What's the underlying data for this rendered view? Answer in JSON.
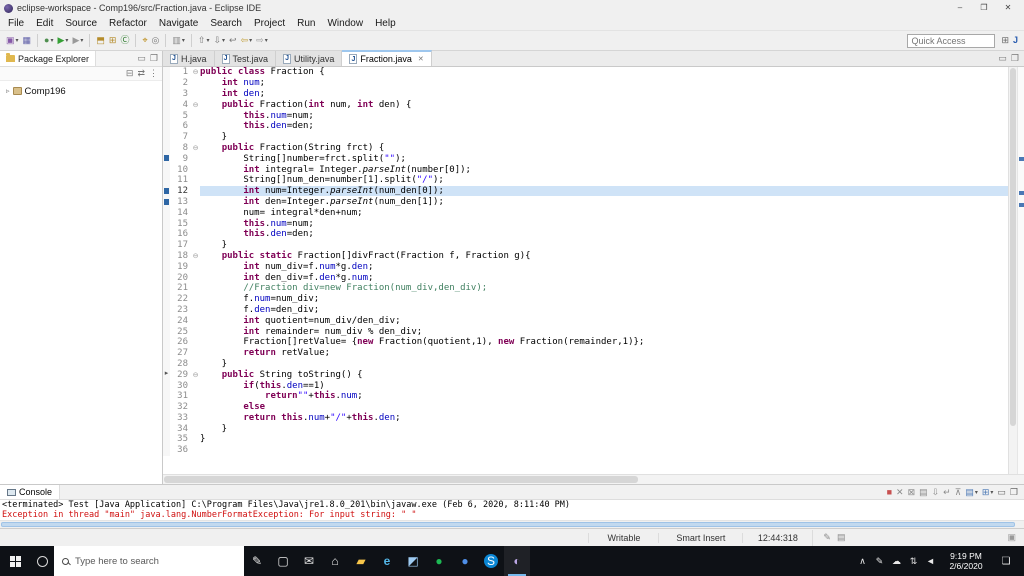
{
  "titlebar": {
    "title": "eclipse-workspace - Comp196/src/Fraction.java - Eclipse IDE",
    "controls": [
      {
        "name": "minimize-button",
        "glyph": "–",
        "color": "#444"
      },
      {
        "name": "restore-button",
        "glyph": "❐",
        "color": "#444"
      },
      {
        "name": "close-button",
        "glyph": "✕",
        "color": "#444"
      }
    ]
  },
  "menubar": [
    "File",
    "Edit",
    "Source",
    "Refactor",
    "Navigate",
    "Search",
    "Project",
    "Run",
    "Window",
    "Help"
  ],
  "toolbar": {
    "quick_access_placeholder": "Quick Access",
    "icons": [
      {
        "name": "new-wizard-button",
        "glyph": "▣",
        "color": "#8659a8",
        "dd": true
      },
      {
        "name": "save-button",
        "glyph": "▦",
        "color": "#5f5fa8"
      },
      {
        "sep": true
      },
      {
        "name": "debug-button",
        "glyph": "●",
        "color": "#4f8f4f",
        "dd": true
      },
      {
        "name": "run-button",
        "glyph": "▶",
        "color": "#35a035",
        "dd": true
      },
      {
        "name": "external-tools-button",
        "glyph": "▶",
        "color": "#9a9a9a",
        "dd": true
      },
      {
        "sep": true
      },
      {
        "name": "new-java-project-button",
        "glyph": "⬒",
        "color": "#b58c2a"
      },
      {
        "name": "new-package-button",
        "glyph": "⊞",
        "color": "#b58c2a"
      },
      {
        "name": "new-class-button",
        "glyph": "Ⓒ",
        "color": "#2a7a2a"
      },
      {
        "sep": true
      },
      {
        "name": "open-type-button",
        "glyph": "⌖",
        "color": "#b8860b"
      },
      {
        "name": "search-button",
        "glyph": "◎",
        "color": "#777777"
      },
      {
        "sep": true
      },
      {
        "name": "coverage-button",
        "glyph": "▥",
        "color": "#888888",
        "dd": true
      },
      {
        "sep": true
      },
      {
        "name": "previous-annotation-button",
        "glyph": "⇧",
        "color": "#777777",
        "dd": true
      },
      {
        "name": "next-annotation-button",
        "glyph": "⇩",
        "color": "#777777",
        "dd": true
      },
      {
        "name": "last-edit-location-button",
        "glyph": "↩",
        "color": "#777777"
      },
      {
        "name": "back-button",
        "glyph": "⇦",
        "color": "#c2a03c",
        "dd": true
      },
      {
        "name": "forward-button",
        "glyph": "⇨",
        "color": "#9a9a9a",
        "dd": true
      }
    ],
    "perspective_icons": [
      {
        "name": "open-perspective-button",
        "glyph": "⊞",
        "color": "#666666"
      },
      {
        "name": "java-perspective-button",
        "glyph": "J",
        "color": "#2a5db0",
        "bold": true
      }
    ]
  },
  "explorer": {
    "title": "Package Explorer",
    "project": "Comp196",
    "header_icons": [
      {
        "name": "minimize-view-button",
        "glyph": "▭",
        "color": "#777777"
      },
      {
        "name": "maximize-view-button",
        "glyph": "❐",
        "color": "#777777"
      }
    ],
    "toolbar_icons": [
      {
        "name": "collapse-all-button",
        "glyph": "⊟",
        "color": "#777777"
      },
      {
        "name": "link-with-editor-button",
        "glyph": "⇄",
        "color": "#777777"
      },
      {
        "name": "view-menu-button",
        "glyph": "⋮",
        "color": "#777777"
      }
    ]
  },
  "editor": {
    "tabs": [
      {
        "label": "H.java",
        "active": false
      },
      {
        "label": "Test.java",
        "active": false
      },
      {
        "label": "Utility.java",
        "active": false
      },
      {
        "label": "Fraction.java",
        "active": true
      }
    ],
    "tabbar_icons": [
      {
        "name": "minimize-view-button",
        "glyph": "▭",
        "color": "#777777"
      },
      {
        "name": "maximize-view-button",
        "glyph": "❐",
        "color": "#777777"
      }
    ],
    "lines": [
      {
        "n": 1,
        "fold": true,
        "seg": [
          [
            "k",
            "public"
          ],
          [
            "p",
            " "
          ],
          [
            "k",
            "class"
          ],
          [
            "p",
            " Fraction {"
          ]
        ]
      },
      {
        "n": 2,
        "seg": [
          [
            "p",
            "    "
          ],
          [
            "k",
            "int"
          ],
          [
            "p",
            " "
          ],
          [
            "f",
            "num"
          ],
          [
            "p",
            ";"
          ]
        ]
      },
      {
        "n": 3,
        "seg": [
          [
            "p",
            "    "
          ],
          [
            "k",
            "int"
          ],
          [
            "p",
            " "
          ],
          [
            "f",
            "den"
          ],
          [
            "p",
            ";"
          ]
        ]
      },
      {
        "n": 4,
        "fold": true,
        "seg": [
          [
            "p",
            "    "
          ],
          [
            "k",
            "public"
          ],
          [
            "p",
            " Fraction("
          ],
          [
            "k",
            "int"
          ],
          [
            "p",
            " num, "
          ],
          [
            "k",
            "int"
          ],
          [
            "p",
            " den) {"
          ]
        ]
      },
      {
        "n": 5,
        "seg": [
          [
            "p",
            "        "
          ],
          [
            "k",
            "this"
          ],
          [
            "p",
            "."
          ],
          [
            "f",
            "num"
          ],
          [
            "p",
            "=num;"
          ]
        ]
      },
      {
        "n": 6,
        "seg": [
          [
            "p",
            "        "
          ],
          [
            "k",
            "this"
          ],
          [
            "p",
            "."
          ],
          [
            "f",
            "den"
          ],
          [
            "p",
            "=den;"
          ]
        ]
      },
      {
        "n": 7,
        "seg": [
          [
            "p",
            "    }"
          ]
        ]
      },
      {
        "n": 8,
        "fold": true,
        "seg": [
          [
            "p",
            "    "
          ],
          [
            "k",
            "public"
          ],
          [
            "p",
            " Fraction(String frct) {"
          ]
        ]
      },
      {
        "n": 9,
        "mark": true,
        "seg": [
          [
            "p",
            "        String[]number=frct.split("
          ],
          [
            "s",
            "\"\""
          ],
          [
            "p",
            ");"
          ]
        ]
      },
      {
        "n": 10,
        "seg": [
          [
            "p",
            "        "
          ],
          [
            "k",
            "int"
          ],
          [
            "p",
            " integral= Integer."
          ],
          [
            "i",
            "parseInt"
          ],
          [
            "p",
            "(number[0]);"
          ]
        ]
      },
      {
        "n": 11,
        "seg": [
          [
            "p",
            "        String[]num_den=number[1].split("
          ],
          [
            "s",
            "\"/\""
          ],
          [
            "p",
            ");"
          ]
        ]
      },
      {
        "n": 12,
        "hl": true,
        "mark": true,
        "seg": [
          [
            "p",
            "        "
          ],
          [
            "k",
            "int"
          ],
          [
            "p",
            " num=Integer."
          ],
          [
            "i",
            "parseInt"
          ],
          [
            "p",
            "(num_den[0]);"
          ]
        ]
      },
      {
        "n": 13,
        "mark": true,
        "seg": [
          [
            "p",
            "        "
          ],
          [
            "k",
            "int"
          ],
          [
            "p",
            " den=Integer."
          ],
          [
            "i",
            "parseInt"
          ],
          [
            "p",
            "(num_den[1]);"
          ]
        ]
      },
      {
        "n": 14,
        "seg": [
          [
            "p",
            "        num= integral*den+num;"
          ]
        ]
      },
      {
        "n": 15,
        "seg": [
          [
            "p",
            "        "
          ],
          [
            "k",
            "this"
          ],
          [
            "p",
            "."
          ],
          [
            "f",
            "num"
          ],
          [
            "p",
            "=num;"
          ]
        ]
      },
      {
        "n": 16,
        "seg": [
          [
            "p",
            "        "
          ],
          [
            "k",
            "this"
          ],
          [
            "p",
            "."
          ],
          [
            "f",
            "den"
          ],
          [
            "p",
            "=den;"
          ]
        ]
      },
      {
        "n": 17,
        "seg": [
          [
            "p",
            "    }"
          ]
        ]
      },
      {
        "n": 18,
        "fold": true,
        "seg": [
          [
            "p",
            "    "
          ],
          [
            "k",
            "public"
          ],
          [
            "p",
            " "
          ],
          [
            "k",
            "static"
          ],
          [
            "p",
            " Fraction[]divFract(Fraction f, Fraction g){"
          ]
        ]
      },
      {
        "n": 19,
        "seg": [
          [
            "p",
            "        "
          ],
          [
            "k",
            "int"
          ],
          [
            "p",
            " num_div=f."
          ],
          [
            "f",
            "num"
          ],
          [
            "p",
            "*g."
          ],
          [
            "f",
            "den"
          ],
          [
            "p",
            ";"
          ]
        ]
      },
      {
        "n": 20,
        "seg": [
          [
            "p",
            "        "
          ],
          [
            "k",
            "int"
          ],
          [
            "p",
            " den_div=f."
          ],
          [
            "f",
            "den"
          ],
          [
            "p",
            "*g."
          ],
          [
            "f",
            "num"
          ],
          [
            "p",
            ";"
          ]
        ]
      },
      {
        "n": 21,
        "seg": [
          [
            "p",
            "        "
          ],
          [
            "c",
            "//Fraction div=new Fraction(num_div,den_div);"
          ]
        ]
      },
      {
        "n": 22,
        "seg": [
          [
            "p",
            "        f."
          ],
          [
            "f",
            "num"
          ],
          [
            "p",
            "=num_div;"
          ]
        ]
      },
      {
        "n": 23,
        "seg": [
          [
            "p",
            "        f."
          ],
          [
            "f",
            "den"
          ],
          [
            "p",
            "=den_div;"
          ]
        ]
      },
      {
        "n": 24,
        "seg": [
          [
            "p",
            "        "
          ],
          [
            "k",
            "int"
          ],
          [
            "p",
            " quotient=num_div/den_div;"
          ]
        ]
      },
      {
        "n": 25,
        "seg": [
          [
            "p",
            "        "
          ],
          [
            "k",
            "int"
          ],
          [
            "p",
            " remainder= num_div % den_div;"
          ]
        ]
      },
      {
        "n": 26,
        "seg": [
          [
            "p",
            "        Fraction[]retValue= {"
          ],
          [
            "k",
            "new"
          ],
          [
            "p",
            " Fraction(quotient,1), "
          ],
          [
            "k",
            "new"
          ],
          [
            "p",
            " Fraction(remainder,1)};"
          ]
        ]
      },
      {
        "n": 27,
        "seg": [
          [
            "p",
            "        "
          ],
          [
            "k",
            "return"
          ],
          [
            "p",
            " retValue;"
          ]
        ]
      },
      {
        "n": 28,
        "seg": [
          [
            "p",
            "    }"
          ]
        ]
      },
      {
        "n": 29,
        "fold": true,
        "arrow": true,
        "seg": [
          [
            "p",
            "    "
          ],
          [
            "k",
            "public"
          ],
          [
            "p",
            " String toString() {"
          ]
        ]
      },
      {
        "n": 30,
        "seg": [
          [
            "p",
            "        "
          ],
          [
            "k",
            "if"
          ],
          [
            "p",
            "("
          ],
          [
            "k",
            "this"
          ],
          [
            "p",
            "."
          ],
          [
            "f",
            "den"
          ],
          [
            "p",
            "==1)"
          ]
        ]
      },
      {
        "n": 31,
        "seg": [
          [
            "p",
            "            "
          ],
          [
            "k",
            "return"
          ],
          [
            "s",
            "\"\""
          ],
          [
            "p",
            "+"
          ],
          [
            "k",
            "this"
          ],
          [
            "p",
            "."
          ],
          [
            "f",
            "num"
          ],
          [
            "p",
            ";"
          ]
        ]
      },
      {
        "n": 32,
        "seg": [
          [
            "p",
            "        "
          ],
          [
            "k",
            "else"
          ]
        ]
      },
      {
        "n": 33,
        "seg": [
          [
            "p",
            "        "
          ],
          [
            "k",
            "return"
          ],
          [
            "p",
            " "
          ],
          [
            "k",
            "this"
          ],
          [
            "p",
            "."
          ],
          [
            "f",
            "num"
          ],
          [
            "p",
            "+"
          ],
          [
            "s",
            "\"/\""
          ],
          [
            "p",
            "+"
          ],
          [
            "k",
            "this"
          ],
          [
            "p",
            "."
          ],
          [
            "f",
            "den"
          ],
          [
            "p",
            ";"
          ]
        ]
      },
      {
        "n": 34,
        "seg": [
          [
            "p",
            "    }"
          ]
        ]
      },
      {
        "n": 35,
        "seg": [
          [
            "p",
            "}"
          ]
        ]
      },
      {
        "n": 36,
        "seg": []
      }
    ]
  },
  "console": {
    "tab": "Console",
    "line1": "<terminated> Test [Java Application] C:\\Program Files\\Java\\jre1.8.0_201\\bin\\javaw.exe (Feb 6, 2020, 8:11:40 PM)",
    "line2": "Exception in thread \"main\" java.lang.NumberFormatException: For input string: \" \"",
    "icons": [
      {
        "name": "terminate-button",
        "glyph": "■",
        "color": "#c75050"
      },
      {
        "name": "remove-launch-button",
        "glyph": "✕",
        "color": "#8a8a8a"
      },
      {
        "name": "remove-all-launches-button",
        "glyph": "⊠",
        "color": "#8a8a8a"
      },
      {
        "name": "clear-console-button",
        "glyph": "▤",
        "color": "#8a8a8a"
      },
      {
        "name": "scroll-lock-button",
        "glyph": "⇩",
        "color": "#8a8a8a"
      },
      {
        "name": "word-wrap-button",
        "glyph": "↵",
        "color": "#8a8a8a"
      },
      {
        "name": "pin-console-button",
        "glyph": "⊼",
        "color": "#8a8a8a"
      },
      {
        "name": "display-selected-console-button",
        "glyph": "▤",
        "color": "#4a78b5",
        "dd": true
      },
      {
        "name": "open-console-button",
        "glyph": "⊞",
        "color": "#4a78b5",
        "dd": true
      },
      {
        "name": "minimize-view-button",
        "glyph": "▭",
        "color": "#666666"
      },
      {
        "name": "maximize-view-button",
        "glyph": "❐",
        "color": "#666666"
      }
    ]
  },
  "statusbar": {
    "writable": "Writable",
    "insert_mode": "Smart Insert",
    "position": "12:44:318",
    "icons": [
      {
        "name": "status-edit-icon",
        "glyph": "✎",
        "color": "#888888",
        "click": false
      },
      {
        "name": "status-list-icon",
        "glyph": "▤",
        "color": "#888888",
        "click": false
      }
    ],
    "end_icons": [
      {
        "name": "status-end-icon",
        "glyph": "▣",
        "color": "#999999",
        "click": false
      }
    ]
  },
  "taskbar": {
    "search_placeholder": "Type here to search",
    "apps": [
      {
        "name": "pen-app-button",
        "glyph": "✎",
        "color": "#e8e8e8"
      },
      {
        "name": "task-view-button",
        "glyph": "▢",
        "color": "#e8e8e8"
      },
      {
        "name": "mail-app-button",
        "glyph": "✉",
        "color": "#e8e8e8"
      },
      {
        "name": "store-app-button",
        "glyph": "⌂",
        "color": "#e8e8e8"
      },
      {
        "name": "file-explorer-button",
        "glyph": "▰",
        "color": "#f6c54a"
      },
      {
        "name": "edge-button",
        "glyph": "e",
        "color": "#53b7e8",
        "bold": true
      },
      {
        "name": "photos-app-button",
        "glyph": "◩",
        "color": "#9ecbf2"
      },
      {
        "name": "spotify-button",
        "glyph": "●",
        "color": "#1db954"
      },
      {
        "name": "messenger-button",
        "glyph": "●",
        "color": "#4f8fe8"
      },
      {
        "name": "skype-button",
        "glyph": "S",
        "color": "#ffffff",
        "bg": "#0a86d4"
      },
      {
        "name": "eclipse-app-button",
        "glyph": "◐",
        "color": "#bba6e4",
        "active": true
      }
    ],
    "tray": [
      {
        "name": "tray-expand-button",
        "glyph": "∧",
        "color": "#e8e8e8"
      },
      {
        "name": "tray-pen-button",
        "glyph": "✎",
        "color": "#e8e8e8"
      },
      {
        "name": "onedrive-button",
        "glyph": "☁",
        "color": "#e8e8e8"
      },
      {
        "name": "network-button",
        "glyph": "⇅",
        "color": "#e8e8e8"
      },
      {
        "name": "volume-button",
        "glyph": "◄",
        "color": "#e8e8e8"
      }
    ],
    "clock": {
      "time": "9:19 PM",
      "date": "2/6/2020"
    }
  },
  "glyphs": {
    "tree_chevron": "▹",
    "fold": "⊖",
    "arrow_marker": "▸",
    "tab_close": "✕",
    "java_file": "J"
  }
}
